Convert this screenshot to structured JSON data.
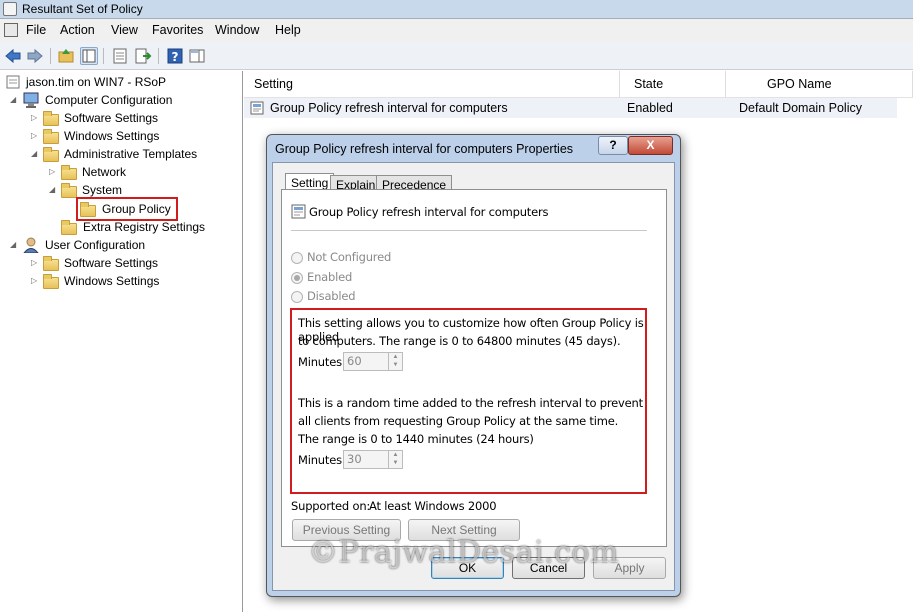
{
  "window": {
    "title": "Resultant Set of Policy"
  },
  "menu": [
    "File",
    "Action",
    "View",
    "Favorites",
    "Window",
    "Help"
  ],
  "toolbar": {
    "icons": [
      "back-arrow-icon",
      "forward-arrow-icon",
      "up-folder-icon",
      "show-hide-tree-icon",
      "properties-icon",
      "export-list-icon",
      "help-icon",
      "action-pane-icon"
    ]
  },
  "tree": {
    "root": "jason.tim on WIN7 - RSoP",
    "computer_configuration": "Computer Configuration",
    "software_settings": "Software Settings",
    "windows_settings": "Windows Settings",
    "administrative_templates": "Administrative Templates",
    "network": "Network",
    "system": "System",
    "group_policy": "Group Policy",
    "extra_registry_settings": "Extra Registry Settings",
    "user_configuration": "User Configuration",
    "user_software_settings": "Software Settings",
    "user_windows_settings": "Windows Settings"
  },
  "list": {
    "columns": [
      "Setting",
      "State",
      "GPO Name"
    ],
    "rows": [
      {
        "setting": "Group Policy refresh interval for computers",
        "state": "Enabled",
        "gpo": "Default Domain Policy"
      }
    ]
  },
  "dialog": {
    "title": "Group Policy refresh interval for computers Properties",
    "help_label": "?",
    "close_label": "X",
    "tabs": [
      "Setting",
      "Explain",
      "Precedence"
    ],
    "active_tab": "Setting",
    "policy_name": "Group Policy refresh interval for computers",
    "options": [
      "Not Configured",
      "Enabled",
      "Disabled"
    ],
    "selected_option": "Enabled",
    "desc1_line1": "This setting allows you to customize how often Group Policy is applied",
    "desc1_line2": "to computers. The range is 0 to 64800 minutes (45 days).",
    "minutes_label": "Minutes:",
    "minutes1_value": "60",
    "desc2_line1": "This is a random time added to the refresh interval to prevent",
    "desc2_line2": "all clients from requesting Group Policy at the same time.",
    "desc2_line3": "The range is 0 to 1440 minutes (24 hours)",
    "minutes2_value": "30",
    "supported_label": "Supported on:",
    "supported_value": "At least Windows 2000",
    "prev_button": "Previous Setting",
    "next_button": "Next Setting",
    "ok_button": "OK",
    "cancel_button": "Cancel",
    "apply_button": "Apply"
  },
  "watermark": "©PrajwalDesai.com",
  "colors": {
    "highlight_red": "#d01c1c",
    "dialog_frame": "#bcd0ea",
    "close_button": "#c14a35"
  }
}
